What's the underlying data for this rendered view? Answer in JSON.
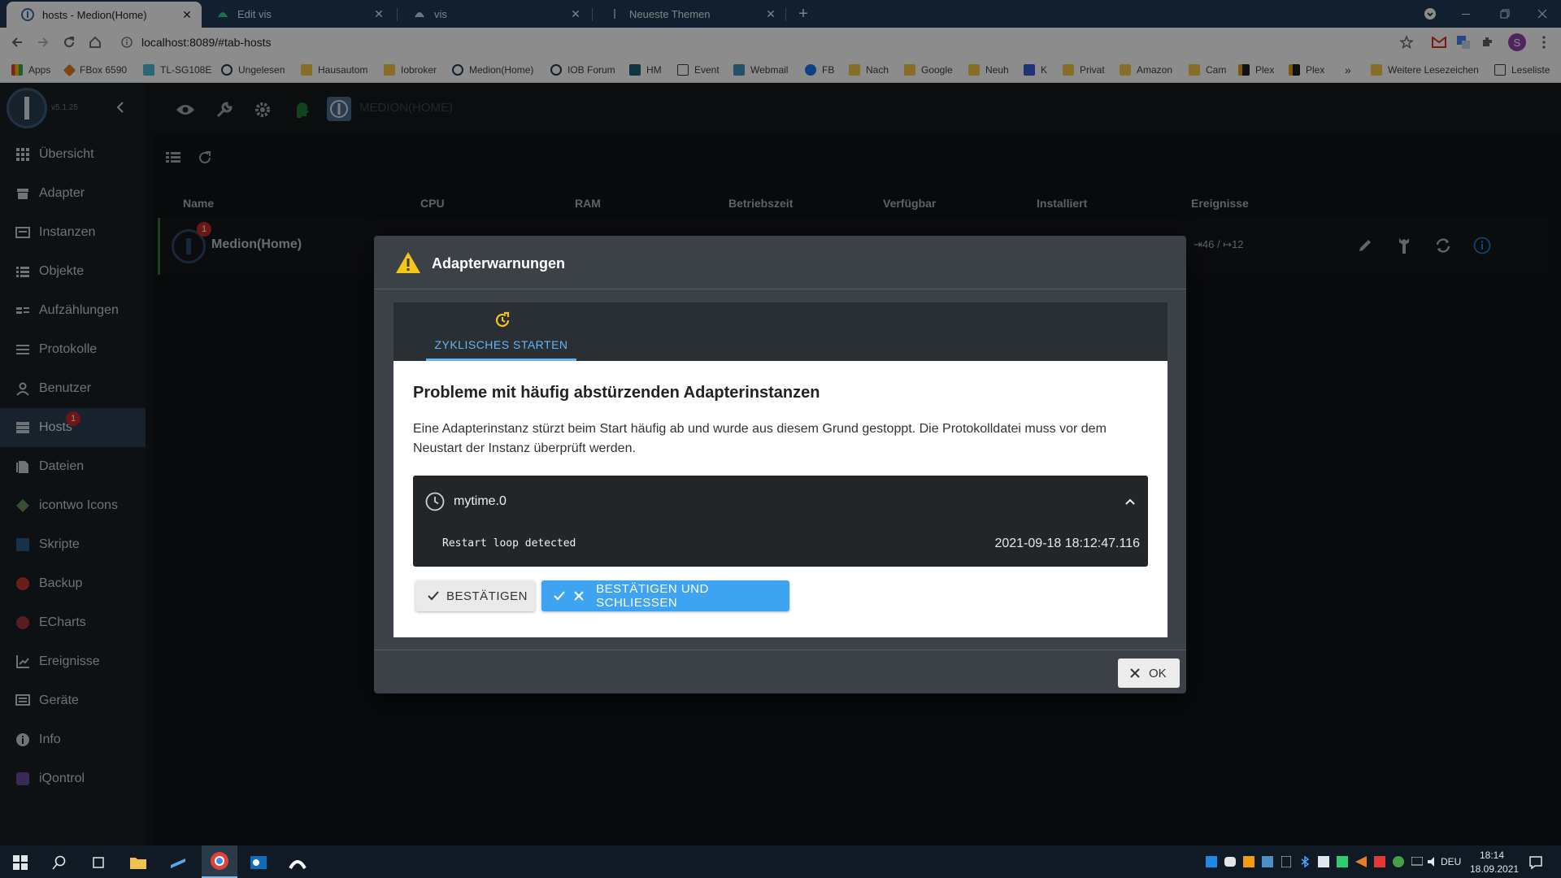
{
  "browser": {
    "tabs": [
      {
        "title": "hosts - Medion(Home)",
        "close": "✕"
      },
      {
        "title": "Edit vis",
        "close": "✕"
      },
      {
        "title": "vis",
        "close": "✕"
      },
      {
        "title": "Neueste Themen",
        "close": "✕"
      }
    ],
    "new_tab": "+",
    "url": "localhost:8089/#tab-hosts",
    "profile_initial": "S",
    "bookmarks": [
      "Apps",
      "FBox 6590",
      "TL-SG108E",
      "Ungelesen",
      "Hausautom",
      "Iobroker",
      "Medion(Home)",
      "IOB Forum",
      "HM",
      "Event",
      "Webmail",
      "FB",
      "Nach",
      "Google",
      "Neuh",
      "K",
      "Privat",
      "Amazon",
      "Cam",
      "Plex",
      "Plex"
    ],
    "bookmarks_more": "»",
    "other_bookmarks": "Weitere Lesezeichen",
    "reading_list": "Leseliste"
  },
  "sidebar": {
    "version": "v5.1.25",
    "items": [
      {
        "label": "Übersicht"
      },
      {
        "label": "Adapter"
      },
      {
        "label": "Instanzen"
      },
      {
        "label": "Objekte"
      },
      {
        "label": "Aufzählungen"
      },
      {
        "label": "Protokolle"
      },
      {
        "label": "Benutzer"
      },
      {
        "label": "Hosts",
        "badge": "1"
      },
      {
        "label": "Dateien"
      },
      {
        "label": "icontwo Icons"
      },
      {
        "label": "Skripte"
      },
      {
        "label": "Backup"
      },
      {
        "label": "ECharts"
      },
      {
        "label": "Ereignisse"
      },
      {
        "label": "Geräte"
      },
      {
        "label": "Info"
      },
      {
        "label": "iQontrol"
      }
    ]
  },
  "topbar": {
    "host_title": "MEDION(HOME)"
  },
  "hosts_table": {
    "columns": [
      "Name",
      "CPU",
      "RAM",
      "Betriebszeit",
      "Verfügbar",
      "Installiert",
      "Ereignisse"
    ],
    "row": {
      "name": "Medion(Home)",
      "badge": "1",
      "events": "⇥46 / ↦12"
    }
  },
  "dialog": {
    "title": "Adapterwarnungen",
    "tab_label": "ZYKLISCHES STARTEN",
    "heading": "Probleme mit häufig abstürzenden Adapterinstanzen",
    "description": "Eine Adapterinstanz stürzt beim Start häufig ab und wurde aus diesem Grund gestoppt. Die Protokolldatei muss vor dem Neustart der Instanz überprüft werden.",
    "instance": {
      "name": "mytime.0",
      "message": "Restart loop detected",
      "timestamp": "2021-09-18 18:12:47.116"
    },
    "btn_confirm": "BESTÄTIGEN",
    "btn_confirm_close": "BESTÄTIGEN UND SCHLIESSEN",
    "btn_ok": "OK"
  },
  "taskbar": {
    "lang": "DEU",
    "time": "18:14",
    "date": "18.09.2021"
  },
  "colors": {
    "accent": "#3ea3f0",
    "warning": "#f5c518",
    "sidebar_bg": "#1b1f24",
    "badge": "#c62828"
  }
}
